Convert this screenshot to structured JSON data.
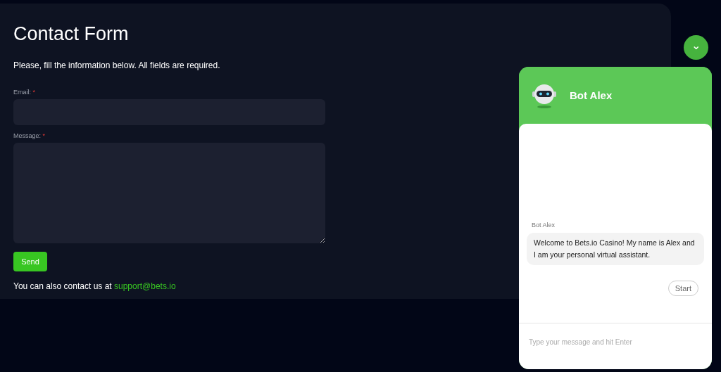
{
  "form": {
    "title": "Contact Form",
    "intro": "Please, fill the information below. All fields are required.",
    "fields": [
      {
        "label": "Email:",
        "required_mark": "*",
        "kind": "input"
      },
      {
        "label": "Message:",
        "required_mark": "*",
        "kind": "textarea"
      }
    ],
    "send_button": "Send",
    "contact_text": "You can also contact us at",
    "contact_link": "support@bets.io"
  },
  "chat": {
    "toggle_icon": "⌄",
    "title": "Bot Alex",
    "sender": "Bot Alex",
    "message": "Welcome to Bets.io Casino! My name is Alex and I am your personal virtual assistant.",
    "start_button": "Start",
    "input": {
      "placeholder": "Type your message and hit Enter"
    }
  }
}
